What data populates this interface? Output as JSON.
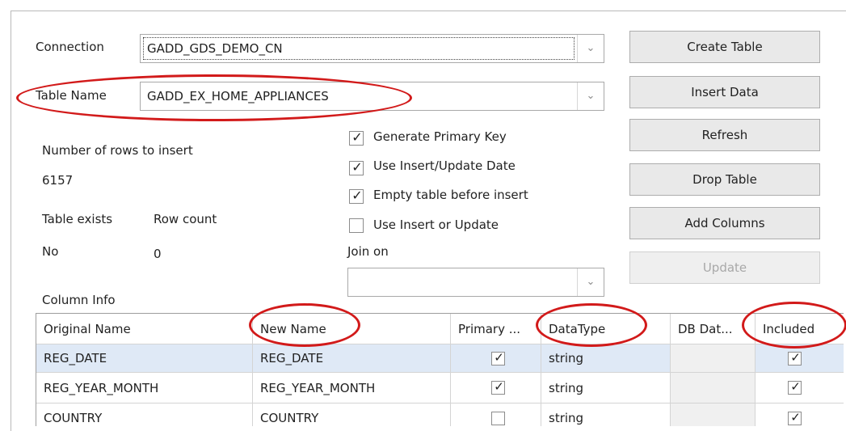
{
  "connection": {
    "label": "Connection",
    "value": "GADD_GDS_DEMO_CN"
  },
  "table_name": {
    "label": "Table Name",
    "value": "GADD_EX_HOME_APPLIANCES"
  },
  "rows_to_insert": {
    "label": "Number of rows to insert",
    "value": "6157"
  },
  "table_exists": {
    "label": "Table exists",
    "value": "No"
  },
  "row_count": {
    "label": "Row count",
    "value": "0"
  },
  "options": {
    "generate_primary_key": {
      "label": "Generate Primary Key",
      "checked": true
    },
    "use_insert_update_date": {
      "label": "Use Insert/Update Date",
      "checked": true
    },
    "empty_table_before_insert": {
      "label": "Empty table before insert",
      "checked": true
    },
    "use_insert_or_update": {
      "label": "Use Insert or Update",
      "checked": false
    }
  },
  "join_on": {
    "label": "Join on",
    "value": ""
  },
  "buttons": {
    "create_table": "Create Table",
    "insert_data": "Insert Data",
    "refresh": "Refresh",
    "drop_table": "Drop Table",
    "add_columns": "Add Columns",
    "update": "Update"
  },
  "column_info": {
    "label": "Column Info",
    "headers": [
      "Original Name",
      "New Name",
      "Primary ...",
      "DataType",
      "DB Dat...",
      "Included"
    ],
    "rows": [
      {
        "original": "REG_DATE",
        "new": "REG_DATE",
        "primary": true,
        "datatype": "string",
        "db": "",
        "included": true
      },
      {
        "original": "REG_YEAR_MONTH",
        "new": "REG_YEAR_MONTH",
        "primary": true,
        "datatype": "string",
        "db": "",
        "included": true
      },
      {
        "original": "COUNTRY",
        "new": "COUNTRY",
        "primary": false,
        "datatype": "string",
        "db": "",
        "included": true
      }
    ]
  },
  "icons": {
    "dropdown": "chevron-down-icon",
    "check": "checkmark-icon"
  },
  "highlight_color": "#d21a1a"
}
